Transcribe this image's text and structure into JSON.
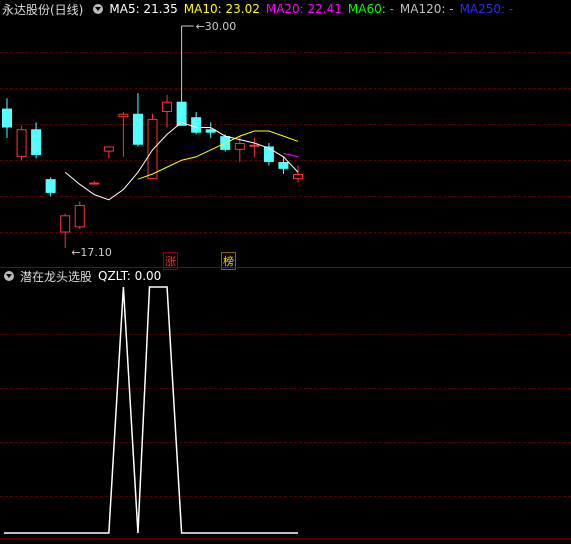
{
  "main_header": {
    "title": "永达股份(日线)",
    "ma5_label": "MA5: 21.35",
    "ma10_label": "MA10: 23.02",
    "ma20_label": "MA20: 22.41",
    "ma60_label": "MA60: -",
    "ma120_label": "MA120: -",
    "ma250_label": "MA250: -"
  },
  "annotations": {
    "high_label": "30.00",
    "low_label": "17.10",
    "tag_zhang": "涨",
    "tag_bang": "榜"
  },
  "sub_header": {
    "title": "潜在龙头选股",
    "value_label": "QZLT: 0.00"
  },
  "colors": {
    "up": "#ff3232",
    "down": "#54ffff",
    "ma5": "#ffffff",
    "ma10": "#ffff00",
    "ma20": "#ff00ff",
    "ma60": "#00ff00",
    "ma120": "#c0c0c0",
    "ma250": "#2a2aff"
  },
  "candles": [
    {
      "o": 25.2,
      "h": 25.8,
      "l": 23.5,
      "c": 24.1
    },
    {
      "o": 22.4,
      "h": 24.2,
      "l": 22.2,
      "c": 24.0
    },
    {
      "o": 24.0,
      "h": 24.4,
      "l": 22.3,
      "c": 22.5
    },
    {
      "o": 21.1,
      "h": 21.2,
      "l": 20.1,
      "c": 20.3
    },
    {
      "o": 18.0,
      "h": 19.1,
      "l": 17.1,
      "c": 19.0
    },
    {
      "o": 18.3,
      "h": 19.8,
      "l": 18.2,
      "c": 19.6
    },
    {
      "o": 20.9,
      "h": 21.0,
      "l": 20.9,
      "c": 20.9
    },
    {
      "o": 22.7,
      "h": 23.0,
      "l": 22.3,
      "c": 23.0
    },
    {
      "o": 24.7,
      "h": 25.0,
      "l": 22.4,
      "c": 24.9
    },
    {
      "o": 24.9,
      "h": 26.1,
      "l": 23.0,
      "c": 23.1
    },
    {
      "o": 21.1,
      "h": 24.9,
      "l": 21.1,
      "c": 24.6
    },
    {
      "o": 25.0,
      "h": 26.0,
      "l": 24.1,
      "c": 25.6
    },
    {
      "o": 25.6,
      "h": 30.0,
      "l": 25.4,
      "c": 24.2
    },
    {
      "o": 24.7,
      "h": 25.0,
      "l": 23.7,
      "c": 23.8
    },
    {
      "o": 24.0,
      "h": 24.4,
      "l": 23.5,
      "c": 23.8
    },
    {
      "o": 23.6,
      "h": 23.7,
      "l": 22.7,
      "c": 22.8
    },
    {
      "o": 22.8,
      "h": 23.6,
      "l": 22.1,
      "c": 23.2
    },
    {
      "o": 23.0,
      "h": 23.5,
      "l": 22.4,
      "c": 23.1
    },
    {
      "o": 23.0,
      "h": 23.2,
      "l": 21.9,
      "c": 22.1
    },
    {
      "o": 22.1,
      "h": 22.4,
      "l": 21.4,
      "c": 21.7
    },
    {
      "o": 21.1,
      "h": 21.9,
      "l": 20.9,
      "c": 21.4
    }
  ],
  "ma5_line": [
    null,
    null,
    null,
    null,
    21.5,
    20.8,
    20.2,
    19.9,
    20.5,
    21.5,
    22.8,
    23.7,
    24.4,
    24.1,
    24.1,
    23.6,
    23.4,
    23.2,
    22.9,
    22.4,
    21.5
  ],
  "ma10_line": [
    null,
    null,
    null,
    null,
    null,
    null,
    null,
    null,
    null,
    21.1,
    21.4,
    21.8,
    22.2,
    22.4,
    22.8,
    23.2,
    23.6,
    23.9,
    23.9,
    23.6,
    23.3
  ],
  "ma20_line": [
    null,
    null,
    null,
    null,
    null,
    null,
    null,
    null,
    null,
    null,
    null,
    null,
    null,
    null,
    null,
    null,
    null,
    null,
    null,
    22.6,
    22.4
  ],
  "qzlt": [
    0,
    0,
    0,
    0,
    0,
    0,
    0,
    0,
    1,
    0,
    1,
    1,
    0,
    0,
    0,
    0,
    0,
    0,
    0,
    0,
    0
  ]
}
